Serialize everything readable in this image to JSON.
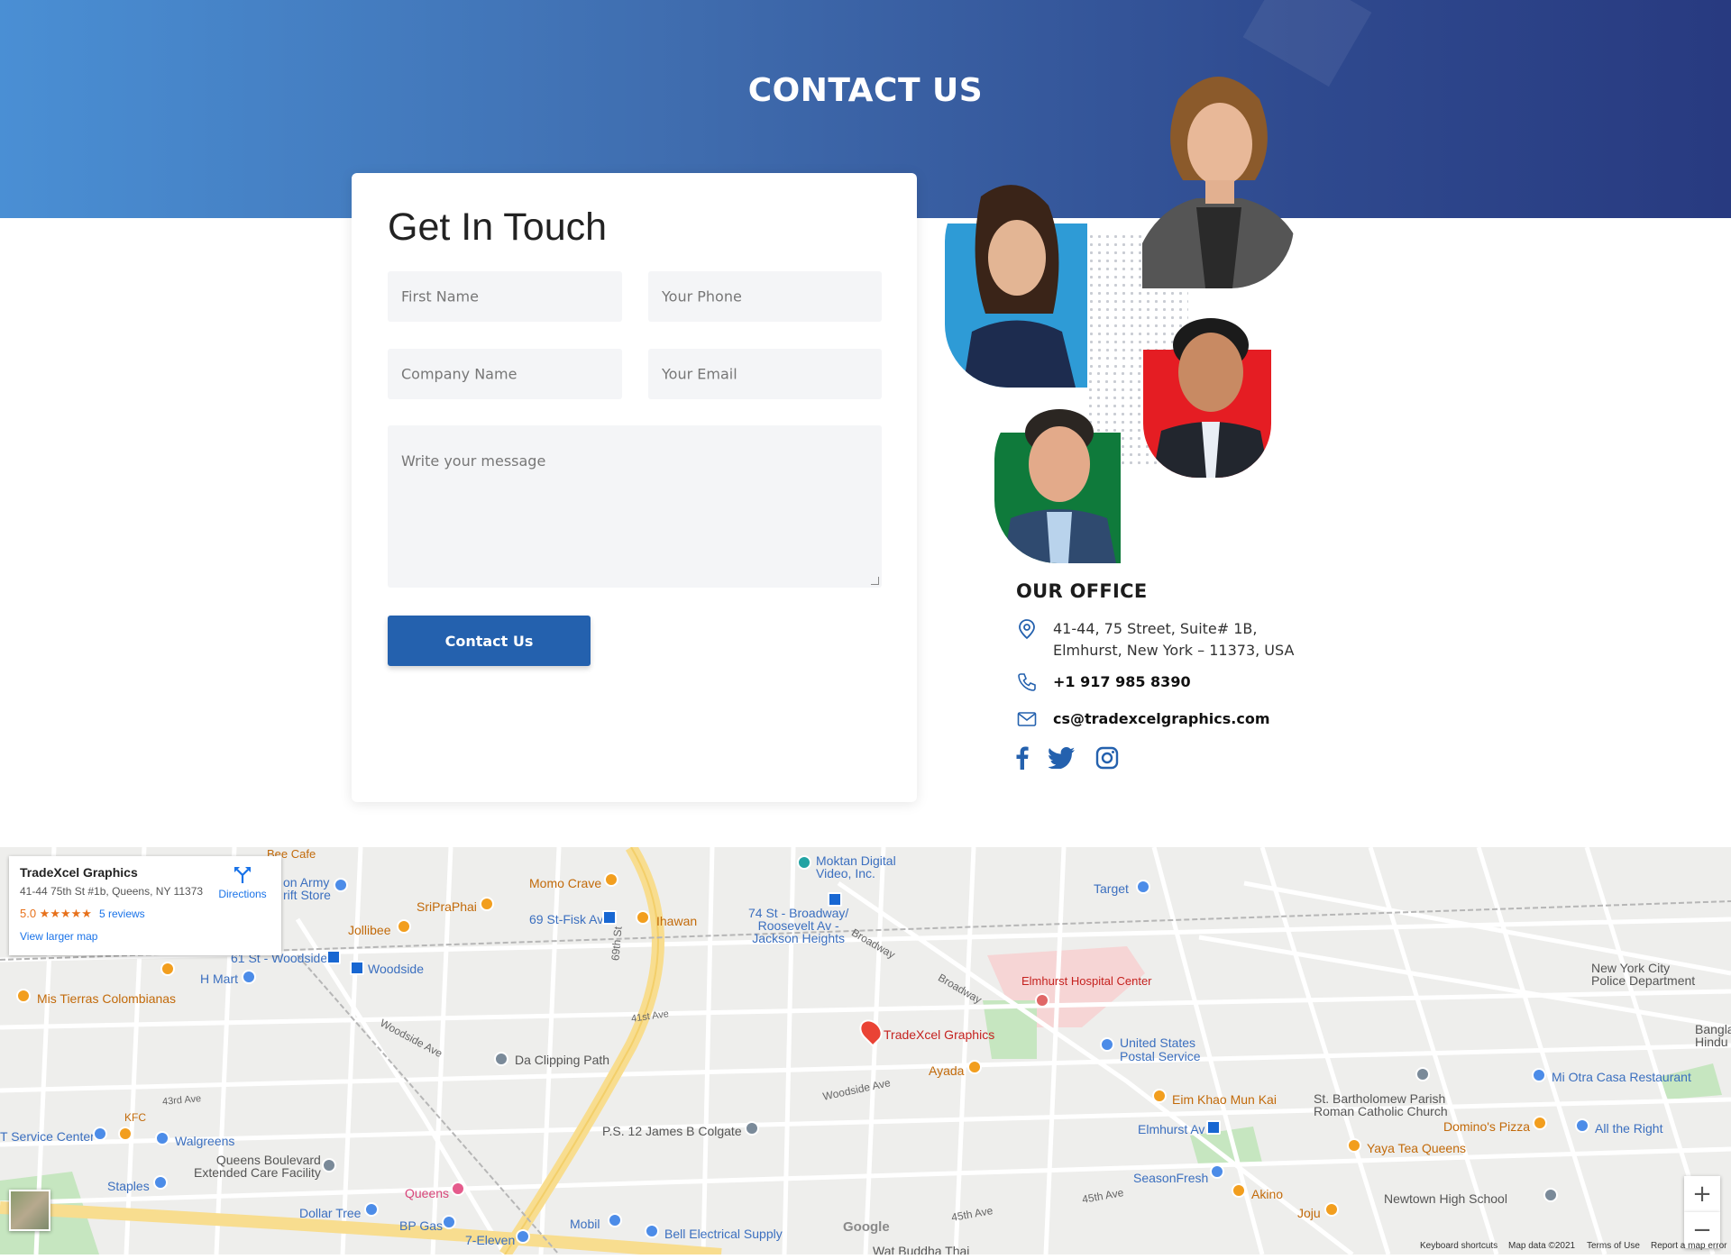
{
  "hero": {
    "title": "CONTACT US"
  },
  "form": {
    "heading": "Get In Touch",
    "first_name_placeholder": "First Name",
    "phone_placeholder": "Your Phone",
    "company_placeholder": "Company Name",
    "email_placeholder": "Your Email",
    "message_placeholder": "Write your message",
    "submit_label": "Contact Us"
  },
  "office": {
    "title": "OUR OFFICE",
    "address_line1": "41-44, 75 Street, Suite# 1B,",
    "address_line2": "Elmhurst, New York – 11373, USA",
    "phone": "+1 917 985 8390",
    "email": "cs@tradexcelgraphics.com",
    "social_icons": [
      "facebook-icon",
      "twitter-icon",
      "instagram-icon"
    ]
  },
  "map": {
    "infobox": {
      "name": "TradeXcel Graphics",
      "address": "41-44 75th St #1b, Queens, NY 11373",
      "rating": "5.0 ★★★★★",
      "reviews": "5 reviews",
      "larger_map": "View larger map",
      "directions": "Directions"
    },
    "zoom_in": "+",
    "zoom_out": "−",
    "footer": {
      "google": "Google",
      "shortcuts": "Keyboard shortcuts",
      "map_data": "Map data ©2021",
      "terms": "Terms of Use",
      "report": "Report a map error"
    },
    "labels": {
      "target_pin": "TradeXcel Graphics",
      "elmhurst_hospital": "Elmhurst Hospital Center",
      "ayada": "Ayada",
      "usps": "United States\nPostal Service",
      "da_clipping": "Da Clipping Path",
      "moktan": "Moktan Digital\nVideo, Inc.",
      "target_store": "Target",
      "momo": "Momo Crave",
      "sriprapai": "SriPraPhai",
      "jollibee": "Jollibee",
      "station_69": "69 St-Fisk Av",
      "ihawan": "Ihawan",
      "station_74": "74 St - Broadway/\nRoosevelt Av -\nJackson Heights",
      "station_61": "61 St - Woodside",
      "woodside": "Woodside",
      "hmart": "H Mart",
      "mis_tierras": "Mis Tierras Colombianas",
      "eim_khao": "Eim Khao Mun Kai",
      "elmhurst_av": "Elmhurst Av",
      "st_bart": "St. Bartholomew Parish\nRoman Catholic Church",
      "dominos": "Domino's Pizza",
      "yaya": "Yaya Tea Queens",
      "seasonfresh": "SeasonFresh",
      "akino": "Akino",
      "joju": "Joju",
      "newtown_hs": "Newtown High School",
      "all_right": "All the Right",
      "mi_otra": "Mi Otra Casa Restaurant",
      "nyc_police": "New York City\nPolice Department",
      "bangla": "Bangla\nHindu M",
      "ps12": "P.S. 12 James B Colgate",
      "walgreens": "Walgreens",
      "kfc": "KFC",
      "t_service": "T Service Center",
      "queens_blvd": "Queens Boulevard\nExtended Care Facility",
      "staples": "Staples",
      "queens": "Queens",
      "dollar_tree": "Dollar Tree",
      "bp_gas": "BP Gas",
      "seven_eleven": "7-Eleven",
      "mobil": "Mobil",
      "bell": "Bell Electrical Supply",
      "wat": "Wat Buddha Thai",
      "bee_cafe": "Bee Cafe",
      "army": "on Army\nrift Store",
      "woodside_ave": "Woodside Ave",
      "woodside_ave2": "Woodside Ave",
      "broadway": "Broadway",
      "broadway2": "Broadway",
      "ave45": "45th Ave",
      "ave45b": "45th Ave",
      "st69": "69th St",
      "ave41": "41st Ave",
      "ave43": "43rd Ave"
    }
  },
  "colors": {
    "accent": "#2461ae",
    "hero_start": "#4a8fd4",
    "hero_end": "#283a80",
    "field_bg": "#f4f5f7"
  }
}
